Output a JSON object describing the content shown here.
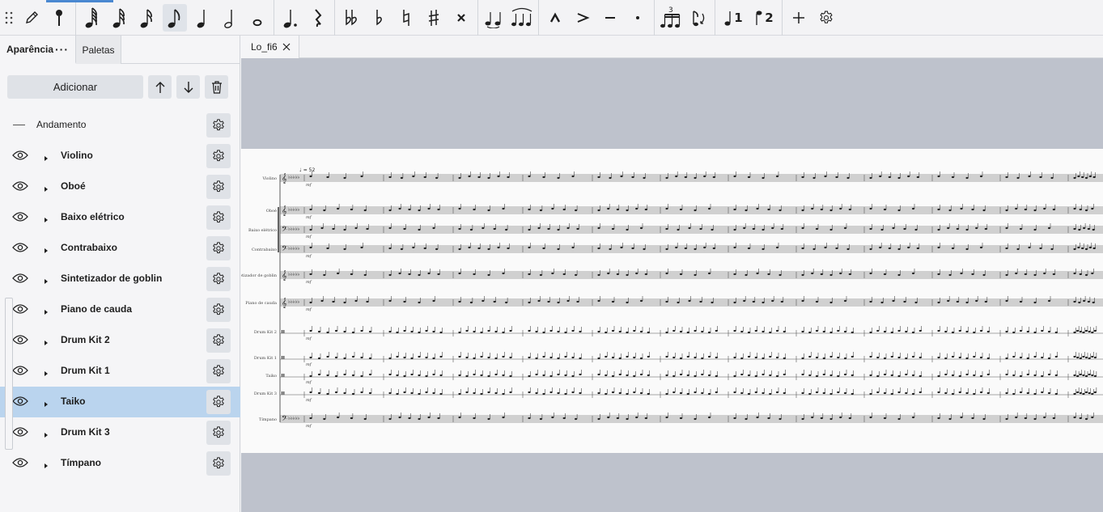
{
  "toolbar": {
    "icons": [
      "drag-handle-icon",
      "pencil-icon",
      "pin-icon",
      "sixtyfourth-note-icon",
      "thirtysecond-note-icon",
      "sixteenth-note-icon",
      "eighth-note-icon",
      "quarter-note-icon",
      "half-note-icon",
      "whole-note-icon",
      "augmentation-dot-icon",
      "rest-icon",
      "double-flat-icon",
      "flat-icon",
      "natural-icon",
      "sharp-icon",
      "double-sharp-icon",
      "tie-icon",
      "slur-icon",
      "marcato-icon",
      "accent-icon",
      "tenuto-icon",
      "staccato-icon",
      "tuplet-icon",
      "flip-direction-icon",
      "voice-1-icon",
      "voice-2-icon",
      "add-icon",
      "settings-icon"
    ],
    "voice_1": "1",
    "voice_2": "2",
    "tuplet_number": "3",
    "active_tool": "eighth-note-icon"
  },
  "panel": {
    "tab_active": "Aparência",
    "tab_menu": "···",
    "tab_inactive": "Paletas",
    "add_button": "Adicionar"
  },
  "instruments": [
    {
      "label": "Andamento",
      "type": "tempo"
    },
    {
      "label": "Violino",
      "type": "instrument"
    },
    {
      "label": "Oboé",
      "type": "instrument"
    },
    {
      "label": "Baixo elétrico",
      "type": "instrument"
    },
    {
      "label": "Contrabaixo",
      "type": "instrument"
    },
    {
      "label": "Sintetizador de goblin",
      "type": "instrument"
    },
    {
      "label": "Piano de cauda",
      "type": "instrument"
    },
    {
      "label": "Drum Kit 2",
      "type": "instrument"
    },
    {
      "label": "Drum Kit 1",
      "type": "instrument"
    },
    {
      "label": "Taiko",
      "type": "instrument",
      "selected": true
    },
    {
      "label": "Drum Kit 3",
      "type": "instrument"
    },
    {
      "label": "Tímpano",
      "type": "instrument"
    }
  ],
  "score": {
    "tab_label": "Lo_fi6",
    "tempo_marking": "♩ = 52",
    "staff_labels": [
      "Violino",
      "Oboé",
      "Baixo elétrico",
      "Contrabaixo",
      "Sintetizador de goblin",
      "Piano de cauda",
      "Drum Kit 2",
      "Drum Kit 1",
      "Taiko",
      "Drum Kit 3",
      "Tímpano"
    ]
  },
  "colors": {
    "accent": "#4a88d1",
    "selected_row": "#bad4ee",
    "canvas": "#bec2cc"
  }
}
